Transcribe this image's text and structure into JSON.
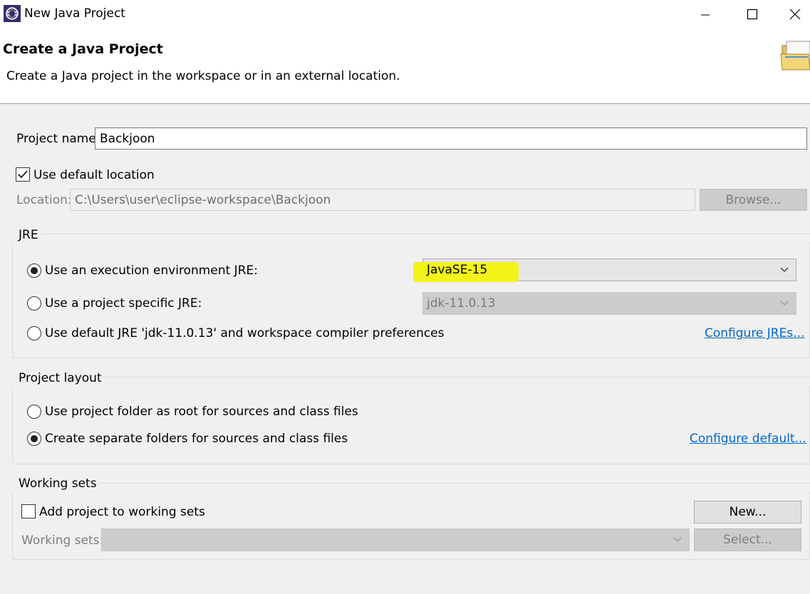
{
  "window": {
    "title": "New Java Project",
    "app_icon": "eclipse-icon",
    "controls": [
      "minimize-icon",
      "maximize-icon",
      "close-icon"
    ]
  },
  "header": {
    "title": "Create a Java Project",
    "description": "Create a Java project in the workspace or in an external location.",
    "banner_icon": "folder-icon"
  },
  "project": {
    "name_label": "Project name:",
    "name_value": "Backjoon",
    "use_default_label": "Use default location",
    "use_default_checked": true,
    "location_label": "Location:",
    "location_value": "C:\\Users\\user\\eclipse-workspace\\Backjoon",
    "browse_label": "Browse..."
  },
  "jre": {
    "group_label": "JRE",
    "exec_env_label": "Use an execution environment JRE:",
    "exec_env_value": "JavaSE-15",
    "project_specific_label": "Use a project specific JRE:",
    "project_specific_value": "jdk-11.0.13",
    "default_jre_label": "Use default JRE 'jdk-11.0.13' and workspace compiler preferences",
    "configure_link": "Configure JREs...",
    "selected": "exec_env"
  },
  "layout": {
    "group_label": "Project layout",
    "root_label": "Use project folder as root for sources and class files",
    "separate_label": "Create separate folders for sources and class files",
    "configure_link": "Configure default...",
    "selected": "separate"
  },
  "working_sets": {
    "group_label": "Working sets",
    "add_label": "Add project to working sets",
    "add_checked": false,
    "new_label": "New...",
    "sets_label": "Working sets:",
    "sets_value": "",
    "select_label": "Select..."
  },
  "colors": {
    "link": "#0066cc",
    "highlight": "#f3f31a"
  }
}
